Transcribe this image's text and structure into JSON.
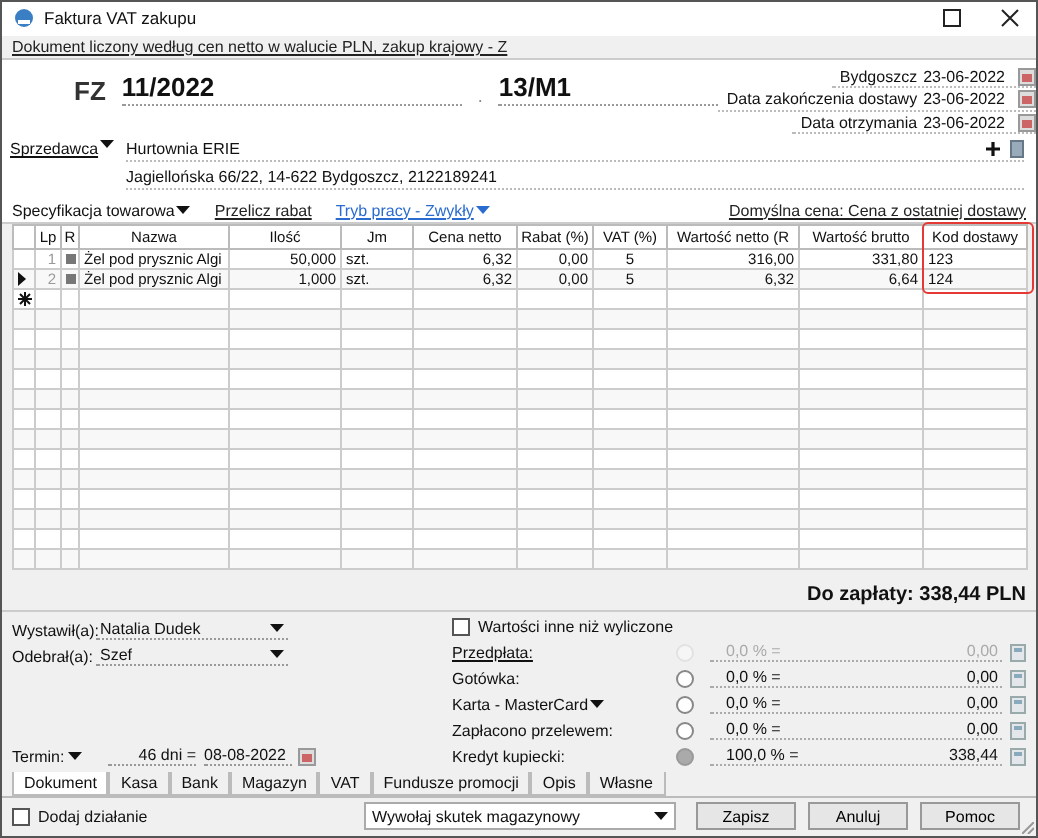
{
  "window": {
    "title": "Faktura VAT zakupu"
  },
  "info_link": "Dokument liczony według cen netto w walucie PLN, zakup krajowy - Z",
  "document": {
    "type": "FZ",
    "number": "11/2022",
    "separator": ".",
    "reference": "13/M1"
  },
  "dates": [
    {
      "label": "Bydgoszcz",
      "value": "23-06-2022"
    },
    {
      "label": "Data zakończenia dostawy",
      "value": "23-06-2022"
    },
    {
      "label": "Data otrzymania",
      "value": "23-06-2022"
    }
  ],
  "seller": {
    "label": "Sprzedawca",
    "name": "Hurtownia ERIE",
    "address": "Jagiellońska  66/22, 14-622 Bydgoszcz, 2122189241"
  },
  "grid_toolbar": {
    "specification": "Specyfikacja towarowa",
    "recalc_link": "Przelicz rabat",
    "mode_link": "Tryb pracy - Zwykły",
    "default_price": "Domyślna cena: Cena z ostatniej dostawy"
  },
  "table": {
    "columns": [
      {
        "label": "Lp",
        "kind": "text"
      },
      {
        "label": "R",
        "kind": "marker"
      },
      {
        "label": "Nazwa",
        "kind": "text"
      },
      {
        "label": "Ilość",
        "kind": "text"
      },
      {
        "label": "Jm",
        "kind": "text"
      },
      {
        "label": "Cena netto",
        "kind": "text"
      },
      {
        "label": "Rabat (%)",
        "kind": "text"
      },
      {
        "label": "VAT (%)",
        "kind": "text"
      },
      {
        "label": "Wartość netto (R",
        "kind": "text"
      },
      {
        "label": "Wartość brutto",
        "kind": "text"
      },
      {
        "label": "Kod dostawy",
        "kind": "text",
        "highlighted": true
      }
    ],
    "rows": [
      {
        "current": false,
        "cells": [
          "1",
          "",
          "Żel pod prysznic Algi",
          "50,000",
          "szt.",
          "6,32",
          "0,00",
          "5",
          "316,00",
          "331,80",
          "123"
        ]
      },
      {
        "current": true,
        "cells": [
          "2",
          "",
          "Żel pod prysznic Algi",
          "1,000",
          "szt.",
          "6,32",
          "0,00",
          "5",
          "6,32",
          "6,64",
          "124"
        ]
      }
    ]
  },
  "total": "Do zapłaty: 338,44 PLN",
  "people": [
    {
      "label": "Wystawił(a):",
      "value": "Natalia Dudek"
    },
    {
      "label": "Odebrał(a):",
      "value": "Szef"
    }
  ],
  "term": {
    "label": "Termin:",
    "days": "46 dni =",
    "date": "08-08-2022"
  },
  "override": {
    "label": "Wartości inne niż wyliczone",
    "checked": false
  },
  "payments": [
    {
      "label": "Przedpłata:",
      "kind": "link",
      "selected": false,
      "disabled": true,
      "percent": "0,0 % =",
      "amount": "0,00"
    },
    {
      "label": "Gotówka:",
      "kind": "plain",
      "selected": false,
      "disabled": false,
      "percent": "0,0 % =",
      "amount": "0,00"
    },
    {
      "label": "Karta - MasterCard",
      "kind": "menu",
      "selected": false,
      "disabled": false,
      "percent": "0,0 % =",
      "amount": "0,00"
    },
    {
      "label": "Zapłacono przelewem:",
      "kind": "plain",
      "selected": false,
      "disabled": false,
      "percent": "0,0 % =",
      "amount": "0,00"
    },
    {
      "label": "Kredyt kupiecki:",
      "kind": "plain",
      "selected": true,
      "disabled": false,
      "percent": "100,0 % =",
      "amount": "338,44"
    }
  ],
  "tabs": [
    {
      "label": "Dokument",
      "selected": true
    },
    {
      "label": "Kasa",
      "selected": false
    },
    {
      "label": "Bank",
      "selected": false
    },
    {
      "label": "Magazyn",
      "selected": false
    },
    {
      "label": "VAT",
      "selected": false
    },
    {
      "label": "Fundusze promocji",
      "selected": false
    },
    {
      "label": "Opis",
      "selected": false
    },
    {
      "label": "Własne",
      "selected": false
    }
  ],
  "footer": {
    "add_action": {
      "label": "Dodaj działanie",
      "checked": false
    },
    "effect": "Wywołaj skutek magazynowy",
    "buttons": [
      "Zapisz",
      "Anuluj",
      "Pomoc"
    ]
  }
}
